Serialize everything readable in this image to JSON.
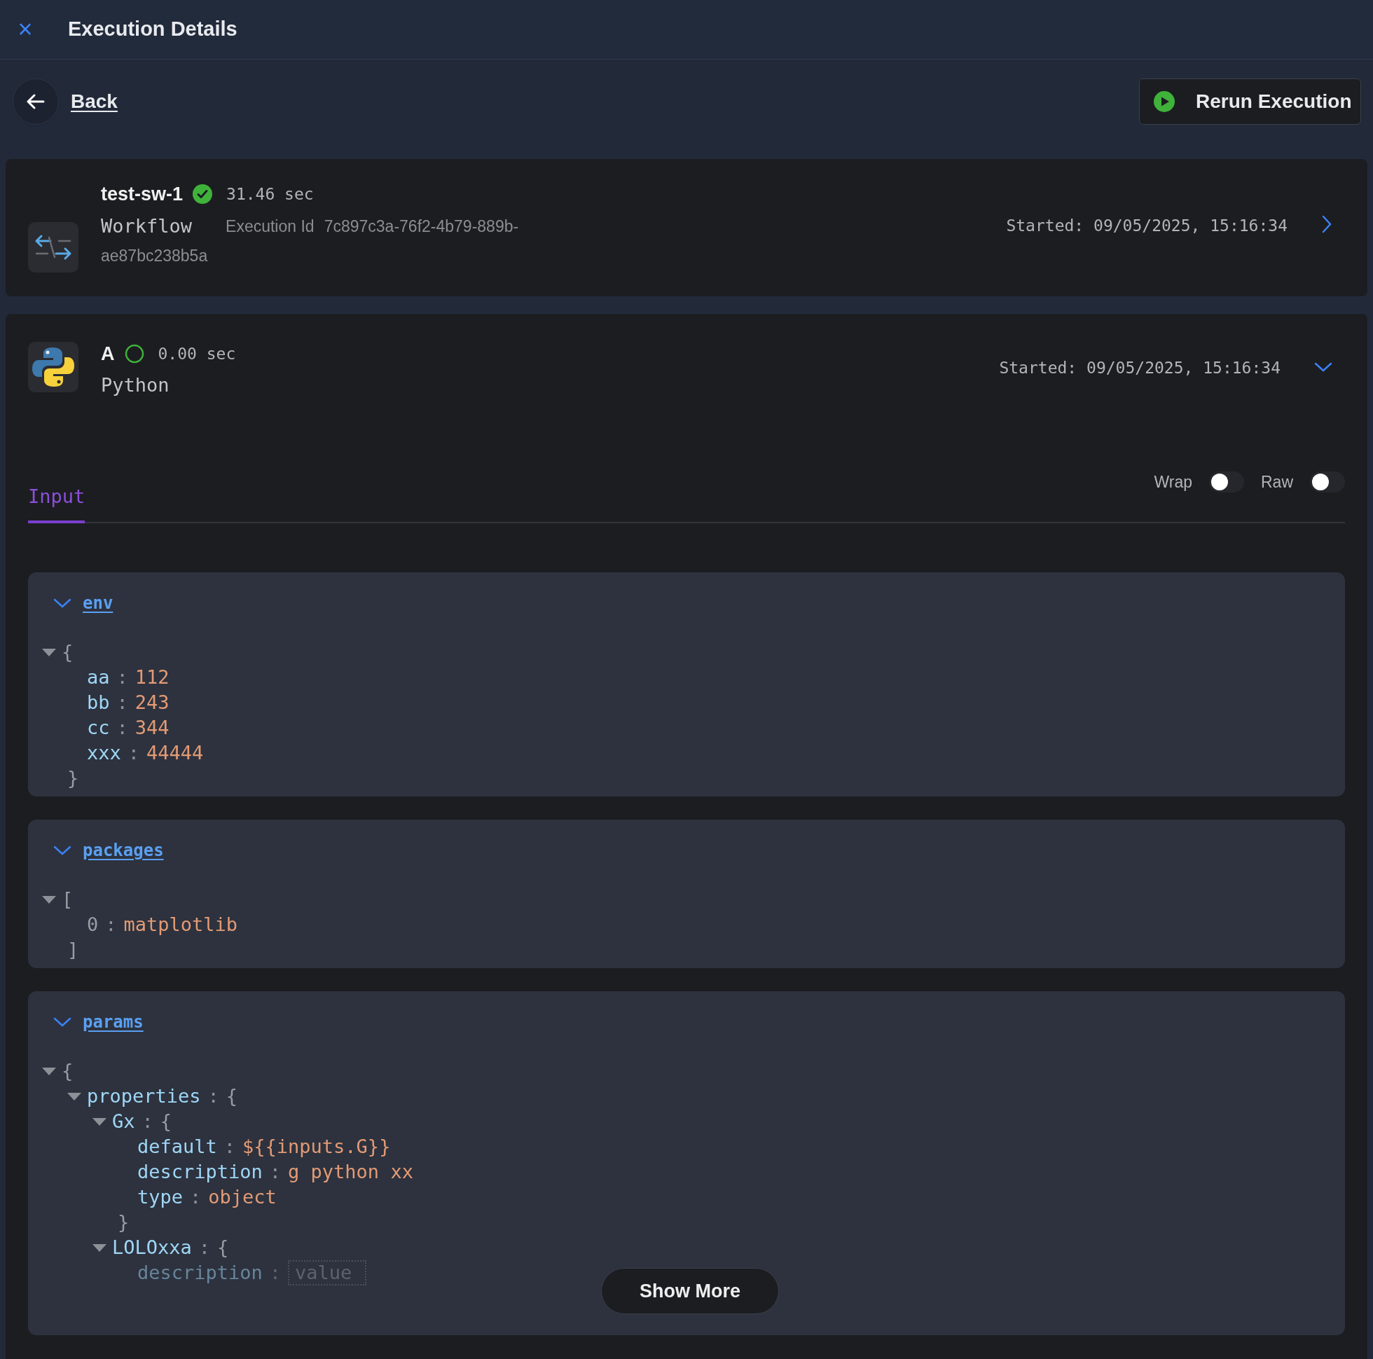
{
  "header": {
    "close_icon": "×",
    "title": "Execution Details"
  },
  "toolbar": {
    "back": "Back",
    "rerun": "Rerun Execution"
  },
  "workflow_card": {
    "name": "test-sw-1",
    "completed": true,
    "duration": "31.46 sec",
    "type": "Workflow",
    "execution_id_label": "Execution Id",
    "execution_id_lines": [
      "7c897c3a-76f2-4b79-889b-",
      "ae87bc238b5a"
    ],
    "started": "Started: 09/05/2025, 15:16:34",
    "expanded": false
  },
  "step_card": {
    "name": "A",
    "completed": false,
    "duration": "0.00 sec",
    "type": "Python",
    "started": "Started: 09/05/2025, 15:16:34",
    "expanded": true,
    "tabs": [
      {
        "label": "Input",
        "selected": true
      }
    ],
    "toggles": [
      {
        "label": "Wrap",
        "on": false
      },
      {
        "label": "Raw",
        "on": false
      }
    ],
    "sections": [
      {
        "title": "env",
        "expanded": true,
        "tree": {
          "open": "{",
          "expanded": true,
          "close": "}",
          "children": [
            {
              "key": "aa",
              "sep": ":",
              "value": "112"
            },
            {
              "key": "bb",
              "sep": ":",
              "value": "243"
            },
            {
              "key": "cc",
              "sep": ":",
              "value": "344"
            },
            {
              "key": "xxx",
              "sep": ":",
              "value": "44444"
            }
          ]
        }
      },
      {
        "title": "packages",
        "expanded": true,
        "tree": {
          "open": "[",
          "expanded": true,
          "close": "]",
          "children": [
            {
              "key": "0",
              "kind": "index",
              "sep": ":",
              "value": "matplotlib"
            }
          ]
        }
      },
      {
        "title": "params",
        "expanded": true,
        "tree": {
          "open": "{",
          "expanded": true,
          "children": [
            {
              "key": "properties",
              "sep": ":",
              "open": "{",
              "expanded": true,
              "children": [
                {
                  "key": "Gx",
                  "sep": ":",
                  "open": "{",
                  "expanded": true,
                  "close": "}",
                  "children": [
                    {
                      "key": "default",
                      "sep": ":",
                      "value": "${{inputs.G}}"
                    },
                    {
                      "key": "description",
                      "sep": ":",
                      "value": "g python xx"
                    },
                    {
                      "key": "type",
                      "sep": ":",
                      "value": "object"
                    }
                  ]
                },
                {
                  "key": "LOLOxxa",
                  "sep": ":",
                  "open": "{",
                  "expanded": true,
                  "children": [
                    {
                      "key": "description",
                      "sep": ":",
                      "kind": "field",
                      "placeholder": "value",
                      "dimmed": true
                    }
                  ]
                }
              ]
            }
          ]
        }
      }
    ],
    "show_more": "Show More"
  }
}
